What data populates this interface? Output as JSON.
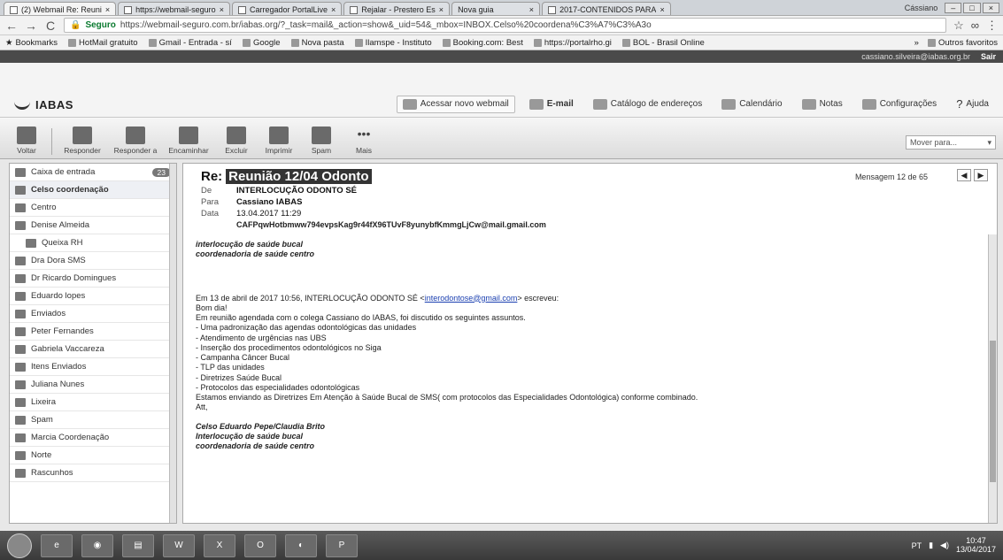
{
  "browser": {
    "tabs": [
      {
        "label": "(2) Webmail Re: Reuni",
        "active": true
      },
      {
        "label": "https://webmail-seguro"
      },
      {
        "label": "Carregador PortalLive"
      },
      {
        "label": "Rejalar - Prestero Es"
      },
      {
        "label": "Nova guia"
      },
      {
        "label": "2017-CONTENIDOS PARA"
      }
    ],
    "window_user": "Cássiano",
    "address": {
      "secure_label": "Seguro",
      "url": "https://webmail-seguro.com.br/iabas.org/?_task=mail&_action=show&_uid=54&_mbox=INBOX.Celso%20coordena%C3%A7%C3%A3o"
    },
    "bookmarks": [
      "Bookmarks",
      "HotMail gratuito",
      "Gmail - Entrada - sí",
      "Google",
      "Nova pasta",
      "Ilamspe - Instituto",
      "Booking.com: Best",
      "https://portalrho.gi",
      "BOL - Brasil Online"
    ],
    "bookmarks_other": "Outros favoritos"
  },
  "darkstrip": {
    "user_email": "cassiano.silveira@iabas.org.br",
    "logout": "Sair"
  },
  "app": {
    "logo": "IABAS",
    "nav": [
      {
        "label": "Acessar novo webmail",
        "icon": "webmail-icon",
        "boxed": true
      },
      {
        "label": "E-mail",
        "icon": "mail-icon",
        "active": true
      },
      {
        "label": "Catálogo de endereços",
        "icon": "contacts-icon"
      },
      {
        "label": "Calendário",
        "icon": "calendar-icon"
      },
      {
        "label": "Notas",
        "icon": "notes-icon"
      },
      {
        "label": "Configurações",
        "icon": "settings-icon"
      },
      {
        "label": "Ajuda",
        "icon": "help-icon"
      }
    ]
  },
  "toolbar": {
    "buttons": [
      {
        "label": "Voltar",
        "icon": "back-arrow-icon"
      },
      {
        "label": "Responder",
        "icon": "reply-icon"
      },
      {
        "label": "Responder a",
        "icon": "reply-all-icon"
      },
      {
        "label": "Encaminhar",
        "icon": "forward-icon"
      },
      {
        "label": "Excluir",
        "icon": "delete-icon"
      },
      {
        "label": "Imprimir",
        "icon": "print-icon"
      },
      {
        "label": "Spam",
        "icon": "spam-icon"
      },
      {
        "label": "Mais",
        "icon": "more-icon"
      }
    ],
    "move_to": "Mover para..."
  },
  "sidebar": {
    "folders": [
      {
        "label": "Caixa de entrada",
        "badge": "23",
        "icon": "inbox-icon"
      },
      {
        "label": "Celso coordenação",
        "active": true,
        "icon": "folder-icon"
      },
      {
        "label": "Centro",
        "icon": "folder-icon"
      },
      {
        "label": "Denise Almeida",
        "icon": "folder-icon"
      },
      {
        "label": "Queixa RH",
        "sub": true,
        "icon": "folder-icon"
      },
      {
        "label": "Dra Dora SMS",
        "icon": "folder-icon"
      },
      {
        "label": "Dr Ricardo Domingues",
        "icon": "folder-icon"
      },
      {
        "label": "Eduardo lopes",
        "icon": "folder-icon"
      },
      {
        "label": "Enviados",
        "icon": "sent-icon"
      },
      {
        "label": "Peter Fernandes",
        "icon": "folder-icon"
      },
      {
        "label": "Gabriela Vaccareza",
        "icon": "folder-icon"
      },
      {
        "label": "Itens Enviados",
        "icon": "folder-icon"
      },
      {
        "label": "Juliana Nunes",
        "icon": "folder-icon"
      },
      {
        "label": "Lixeira",
        "icon": "trash-icon"
      },
      {
        "label": "Spam",
        "icon": "spam-icon"
      },
      {
        "label": "Marcia Coordenação",
        "icon": "folder-icon"
      },
      {
        "label": "Norte",
        "icon": "folder-icon"
      },
      {
        "label": "Rascunhos",
        "icon": "drafts-icon"
      }
    ]
  },
  "message": {
    "subject_prefix": "Re:",
    "subject_highlight": "Reunião 12/04 Odonto",
    "from_label": "De",
    "from": "INTERLOCUÇÃO ODONTO SÉ",
    "to_label": "Para",
    "to": "Cassiano IABAS",
    "date_label": "Data",
    "date": "13.04.2017 11:29",
    "message_id": "CAFPqwHotbmww794evpsKag9r44fX96TUvF8yunybfKmmgLjCw@mail.gmail.com",
    "counter": "Mensagem 12 de 65",
    "signature": [
      "interlocução de saúde bucal",
      "coordenadoria de saúde centro"
    ],
    "quoted_intro_pre": "Em 13 de abril de 2017 10:56, INTERLOCUÇÃO ODONTO SÉ <",
    "quoted_email": "interodontose@gmail.com",
    "quoted_intro_post": "> escreveu:",
    "quoted_lines": [
      "Bom dia!",
      "Em reunião agendada com o colega Cassiano do IABAS, foi discutido os seguintes assuntos.",
      "- Uma padronização das agendas odontológicas das unidades",
      "- Atendimento de urgências nas UBS",
      "- Inserção dos procedimentos odontológicos no Siga",
      "- Campanha Câncer Bucal",
      "- TLP das unidades",
      "- Diretrizes Saúde Bucal",
      "- Protocolos das especialidades odontológicas",
      "Estamos enviando as Diretrizes Em Atenção à Saúde Bucal de SMS( com protocolos das Especialidades Odontológica) conforme combinado.",
      "Att,"
    ],
    "quoted_signature": [
      "Celso Eduardo Pepe/Claudia Brito",
      "Interlocução de saúde bucal",
      "coordenadoria de saúde centro"
    ]
  },
  "taskbar": {
    "apps": [
      "",
      "",
      "",
      "W",
      "X",
      "O",
      "",
      "P"
    ],
    "lang": "PT",
    "time": "10:47",
    "date": "13/04/2017"
  }
}
